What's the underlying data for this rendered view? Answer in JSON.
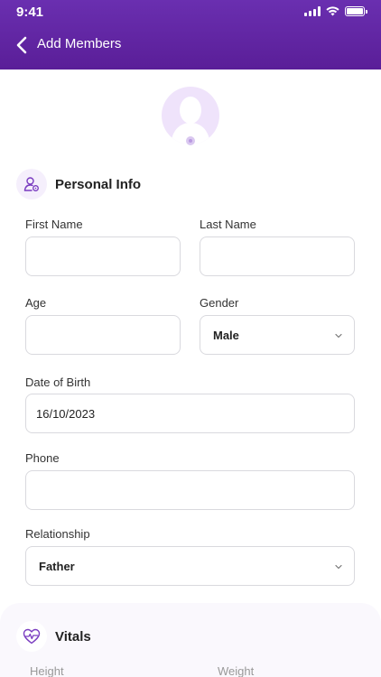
{
  "status_bar": {
    "time": "9:41"
  },
  "header": {
    "title": "Add Members"
  },
  "personal_info": {
    "title": "Personal Info",
    "first_name": {
      "label": "First Name",
      "value": ""
    },
    "last_name": {
      "label": "Last Name",
      "value": ""
    },
    "age": {
      "label": "Age",
      "value": ""
    },
    "gender": {
      "label": "Gender",
      "value": "Male"
    },
    "dob": {
      "label": "Date of Birth",
      "value": "16/10/2023"
    },
    "phone": {
      "label": "Phone",
      "value": ""
    },
    "relationship": {
      "label": "Relationship",
      "value": "Father"
    }
  },
  "vitals": {
    "title": "Vitals",
    "height_label": "Height",
    "weight_label": "Weight"
  },
  "colors": {
    "brand": "#5f23a3",
    "accent_light": "#efe3fb",
    "icon_tint": "#7a3cc0"
  },
  "icons": [
    "back-chevron-icon",
    "avatar-placeholder-icon",
    "person-settings-icon",
    "chevron-down-icon",
    "heart-pulse-icon"
  ]
}
